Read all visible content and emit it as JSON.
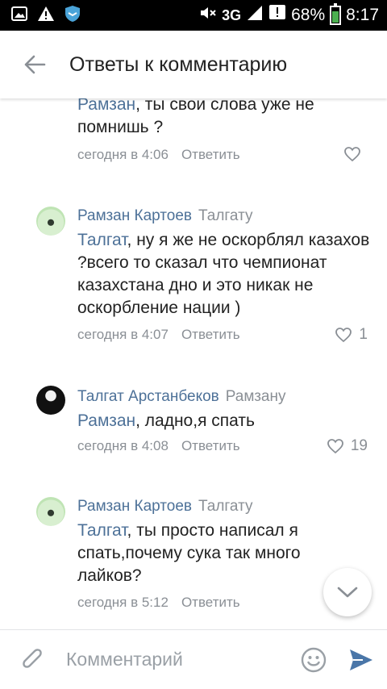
{
  "statusbar": {
    "network": "3G",
    "battery": "68%",
    "time": "8:17"
  },
  "appbar": {
    "title": "Ответы к комментарию"
  },
  "comments": [
    {
      "mention": "Рамзан",
      "text": ", ты свои слова уже не помнишь ?",
      "time": "сегодня в 4:06",
      "reply": "Ответить",
      "likes": ""
    },
    {
      "author": "Рамзан Картоев",
      "to": "Талгату",
      "mention": "Талгат",
      "text": ", ну я же не оскорблял казахов ?всего то сказал что чемпионат казахстана дно и это никак не оскорбление нации )",
      "time": "сегодня в 4:07",
      "reply": "Ответить",
      "likes": "1"
    },
    {
      "author": "Талгат Арстанбеков",
      "to": "Рамзану",
      "mention": "Рамзан",
      "text": ", ладно,я спать",
      "time": "сегодня в 4:08",
      "reply": "Ответить",
      "likes": "19"
    },
    {
      "author": "Рамзан Картоев",
      "to": "Талгату",
      "mention": "Талгат",
      "text": ", ты просто написал я спать,почему сука так много лайков?",
      "time": "сегодня в 5:12",
      "reply": "Ответить",
      "likes": ""
    }
  ],
  "composer": {
    "placeholder": "Комментарий"
  },
  "colors": {
    "link": "#4d7198",
    "meta": "#8a8f95",
    "send": "#4a76a8"
  }
}
